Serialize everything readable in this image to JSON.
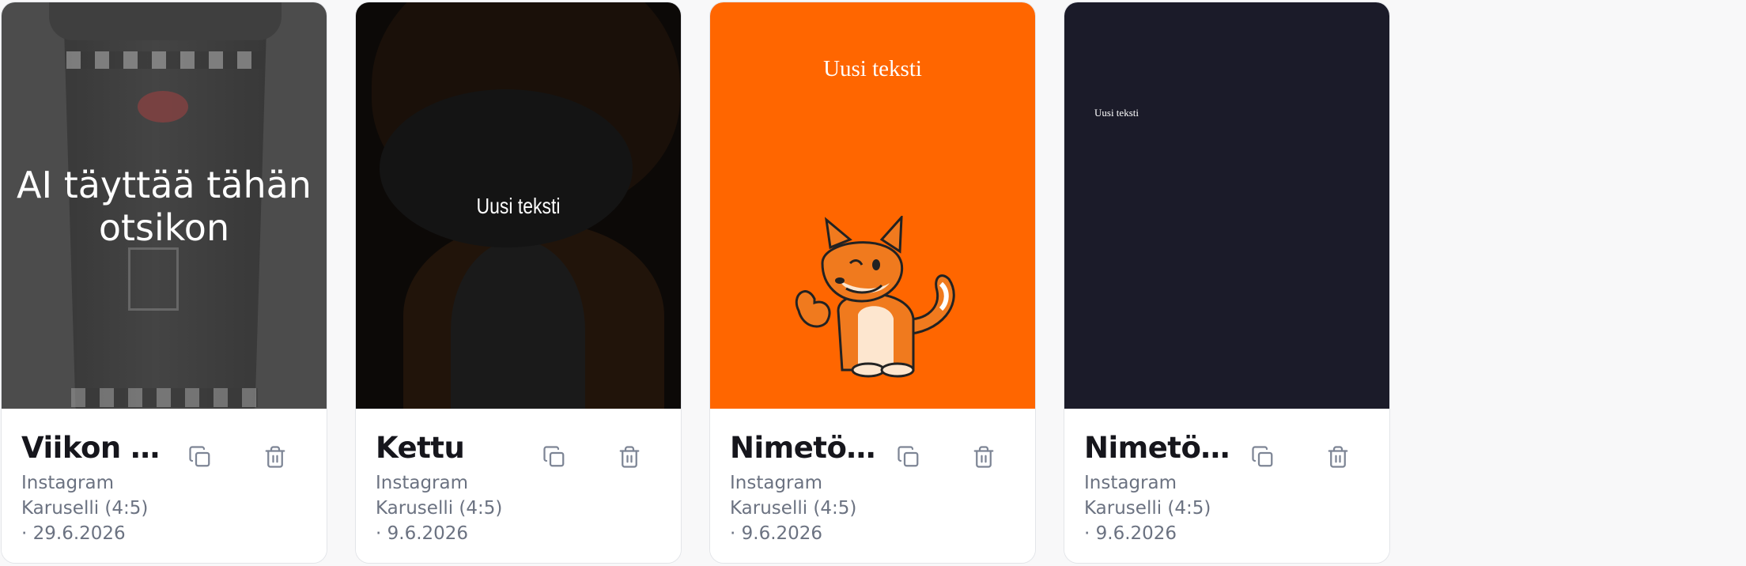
{
  "cards": [
    {
      "title": "Viikon t…",
      "platform": "Instagram",
      "format": "Karuselli (4:5)",
      "date": "· 29.6.2026",
      "preview_text": "AI täyttää tähän otsikon",
      "background": "#4b4b4b"
    },
    {
      "title": "Kettu",
      "platform": "Instagram",
      "format": "Karuselli (4:5)",
      "date": "· 9.6.2026",
      "preview_text": "Uusi teksti",
      "background": "#1c1410"
    },
    {
      "title": "Nimetö…",
      "platform": "Instagram",
      "format": "Karuselli (4:5)",
      "date": "· 9.6.2026",
      "preview_text": "Uusi teksti",
      "background": "#ff6600"
    },
    {
      "title": "Nimetö…",
      "platform": "Instagram",
      "format": "Karuselli (4:5)",
      "date": "· 9.6.2026",
      "preview_text": "Uusi teksti",
      "background": "#1b1b29"
    }
  ],
  "icons": {
    "copy": "copy-icon",
    "delete": "trash-icon"
  },
  "colors": {
    "page_bg": "#f8f8f9",
    "card_bg": "#ffffff",
    "title": "#16161c",
    "meta": "#6b7281",
    "icon": "#7d8595",
    "orange": "#ff6600",
    "navy": "#1b1b29"
  }
}
